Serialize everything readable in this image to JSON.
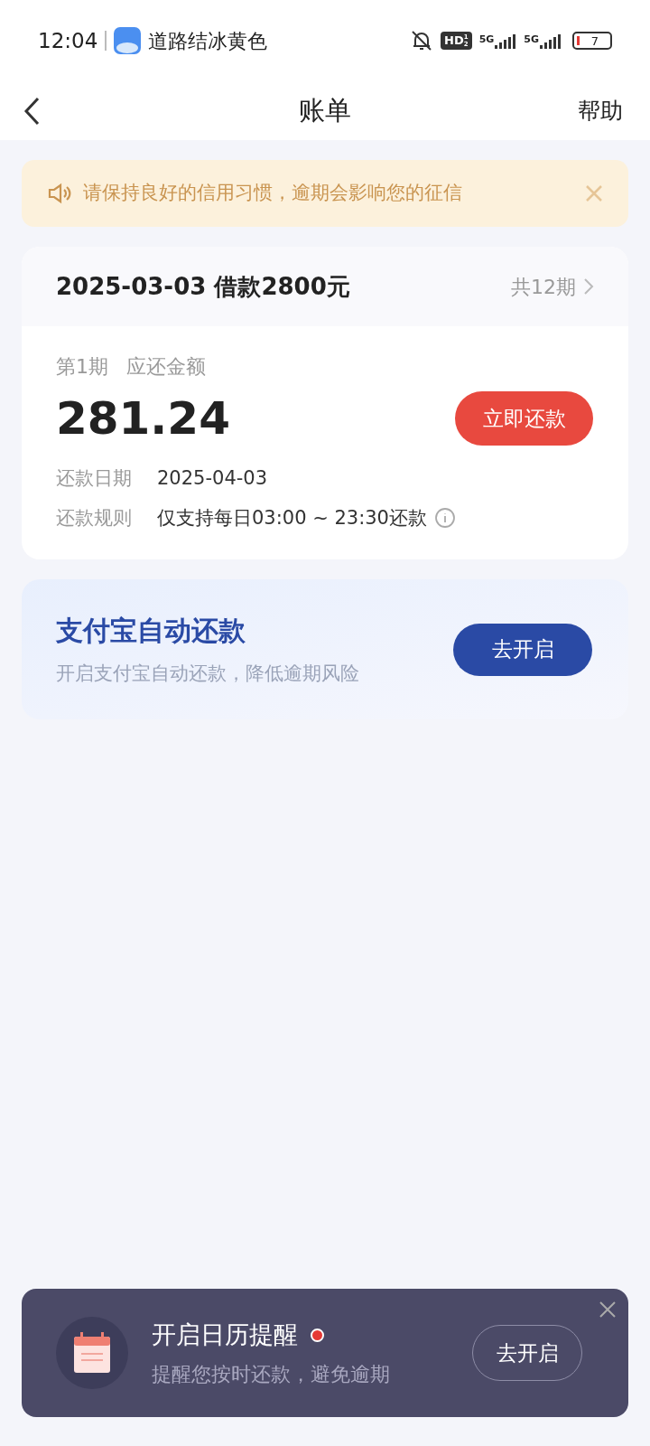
{
  "status_bar": {
    "time": "12:04",
    "notification": "道路结冰黄色",
    "hd": "HD",
    "hd_sub": "1",
    "hd_sub2": "2",
    "networks": [
      "5G",
      "5G"
    ],
    "battery": "7"
  },
  "nav": {
    "title": "账单",
    "action": "帮助"
  },
  "notice": {
    "text": "请保持良好的信用习惯，逾期会影响您的征信"
  },
  "bill": {
    "title_date": "2025-03-03",
    "title_loan": "借款2800元",
    "periods": "共12期",
    "period": "第1期",
    "amount_label": "应还金额",
    "amount": "281.24",
    "pay_button": "立即还款",
    "details": [
      {
        "label": "还款日期",
        "value": "2025-04-03",
        "info": false
      },
      {
        "label": "还款规则",
        "value": "仅支持每日03:00 ~ 23:30还款",
        "info": true
      }
    ]
  },
  "auto_repay": {
    "title": "支付宝自动还款",
    "subtitle": "开启支付宝自动还款，降低逾期风险",
    "button": "去开启"
  },
  "reminder": {
    "title": "开启日历提醒",
    "unread": true,
    "subtitle": "提醒您按时还款，避免逾期",
    "button": "去开启"
  }
}
